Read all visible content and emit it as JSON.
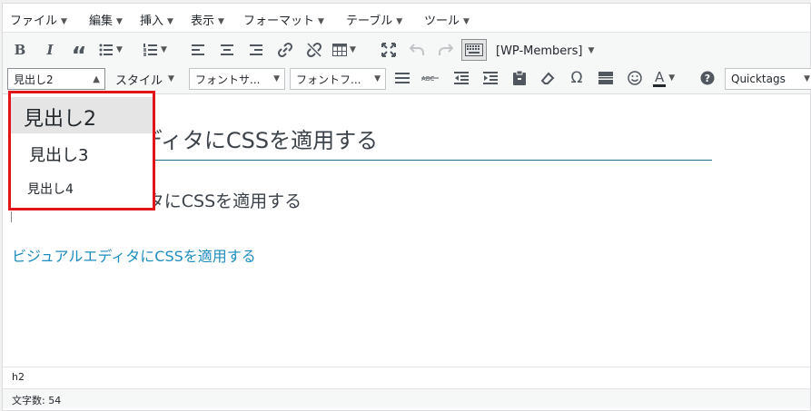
{
  "menubar": {
    "items": [
      {
        "label": "ファイル"
      },
      {
        "label": "編集"
      },
      {
        "label": "挿入"
      },
      {
        "label": "表示"
      },
      {
        "label": "フォーマット"
      },
      {
        "label": "テーブル"
      },
      {
        "label": "ツール"
      }
    ]
  },
  "toolbar1": {
    "bold": "B",
    "italic": "I",
    "blockquote": "“",
    "members_label": "[WP-Members]"
  },
  "toolbar2": {
    "format_select": "見出し2",
    "style_select": "スタイル",
    "font_size_select": "フォントサ...",
    "font_family_select": "フォントフ...",
    "omega": "Ω",
    "text_color": "A",
    "quicktags_select": "Quicktags"
  },
  "dropdown": {
    "items": [
      "見出し2",
      "見出し3",
      "見出し4"
    ],
    "selected": "見出し2",
    "border_color": "#e2141a"
  },
  "content": {
    "h2_text": "ビジュアルエディタにCSSを適用する",
    "h3_text": "ビジュアルエディタにCSSを適用する",
    "h4_text": "ビジュアルエディタにCSSを適用する"
  },
  "status": {
    "path": "h2",
    "word_count": "文字数: 54"
  },
  "colors": {
    "h2_underline": "#1d6f87",
    "link_text": "#1e8cbe"
  }
}
